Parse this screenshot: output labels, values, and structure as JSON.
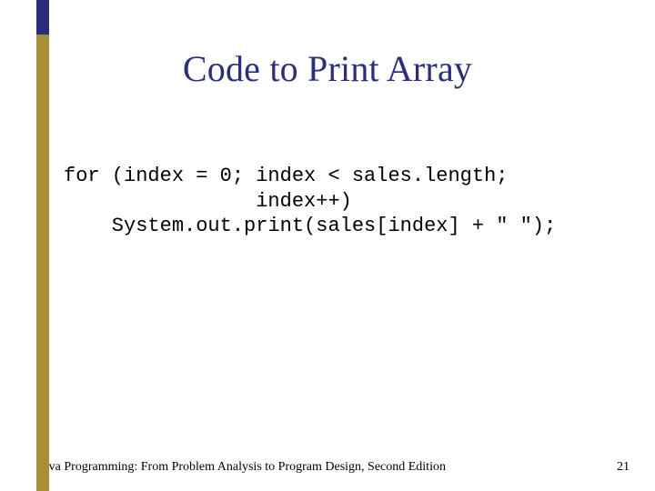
{
  "title": "Code to Print Array",
  "code_lines": {
    "l1": "for (index = 0; index < sales.length;",
    "l2": "                index++)",
    "l3": "    System.out.print(sales[index] + \" \");"
  },
  "footer": "Java Programming: From Problem Analysis to Program Design, Second Edition",
  "page_number": "21",
  "colors": {
    "accent_gold": "#a78f38",
    "accent_navy": "#2b2f7a"
  }
}
